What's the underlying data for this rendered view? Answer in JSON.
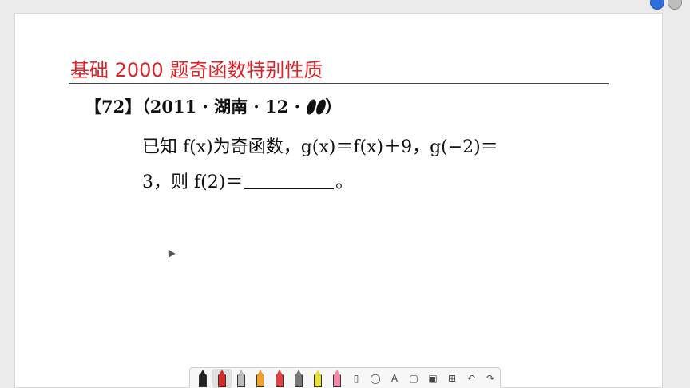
{
  "title": "基础 2000 题奇函数特别性质",
  "problem": {
    "number": "【72】",
    "source": "（2011 · 湖南 · 12 ·",
    "source_close": "）",
    "line1": "已知 f(x)为奇函数，g(x)＝f(x)＋9，g(−2)＝",
    "line2_start": "3，则 f(2)＝",
    "line2_end": "。"
  },
  "colors": {
    "title": "#d9262c",
    "accent_blue": "#2f6fde"
  },
  "toolbar": {
    "tools": [
      {
        "name": "pen-black-tool",
        "type": "pen",
        "color": "#222222"
      },
      {
        "name": "pen-red-tool",
        "type": "pen",
        "color": "#d42b2b",
        "active": true
      },
      {
        "name": "pen-outline-tool",
        "type": "pen",
        "color": "#bbbbbb"
      },
      {
        "name": "pen-orange-tool",
        "type": "pen",
        "color": "#f0a030"
      },
      {
        "name": "pen-red-2-tool",
        "type": "pen",
        "color": "#e04040"
      },
      {
        "name": "pen-gray-tool",
        "type": "pen",
        "color": "#777777"
      },
      {
        "name": "highlighter-yellow-tool",
        "type": "pen",
        "color": "#e8e040"
      },
      {
        "name": "highlighter-pink-tool",
        "type": "pen",
        "color": "#f08aa8"
      },
      {
        "name": "eraser-tool",
        "type": "glyph",
        "glyph": "▯"
      },
      {
        "name": "lasso-tool",
        "type": "glyph",
        "glyph": "◯"
      },
      {
        "name": "text-tool",
        "type": "glyph",
        "glyph": "A"
      },
      {
        "name": "shape-tool",
        "type": "glyph",
        "glyph": "▢"
      },
      {
        "name": "image-tool",
        "type": "glyph",
        "glyph": "▣"
      },
      {
        "name": "add-tool",
        "type": "glyph",
        "glyph": "⊞"
      },
      {
        "name": "undo-icon",
        "type": "glyph",
        "glyph": "↶"
      },
      {
        "name": "redo-icon",
        "type": "glyph",
        "glyph": "↷"
      }
    ]
  }
}
